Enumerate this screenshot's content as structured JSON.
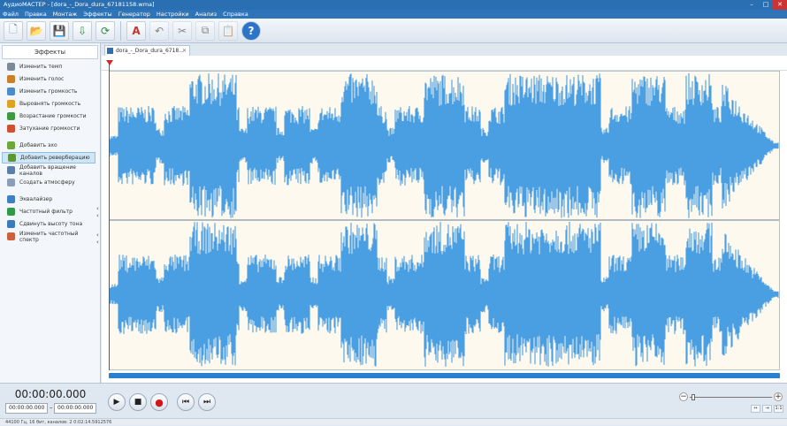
{
  "window": {
    "title": "АудиоМАСТЕР - [dora_-_Dora_dura_67181158.wma]"
  },
  "menu": [
    "Файл",
    "Правка",
    "Монтаж",
    "Эффекты",
    "Генератор",
    "Настройки",
    "Анализ",
    "Справка"
  ],
  "toolbar": {
    "buttons": [
      {
        "icon": "new-file-icon",
        "glyph": "🗋"
      },
      {
        "icon": "open-folder-icon",
        "glyph": "📂"
      },
      {
        "icon": "save-icon",
        "glyph": "💾"
      },
      {
        "icon": "export-icon",
        "glyph": "⇩"
      },
      {
        "icon": "refresh-icon",
        "glyph": "⟳"
      },
      {
        "icon": "edit-text-icon",
        "glyph": "A"
      },
      {
        "icon": "undo-icon",
        "glyph": "↶"
      },
      {
        "icon": "cut-icon",
        "glyph": "✂"
      },
      {
        "icon": "copy-icon",
        "glyph": "⧉"
      },
      {
        "icon": "paste-icon",
        "glyph": "📋"
      },
      {
        "icon": "help-icon",
        "glyph": "?"
      }
    ]
  },
  "sidebar": {
    "header": "Эффекты",
    "items": [
      {
        "label": "Изменить темп",
        "color": "#7a8a99"
      },
      {
        "label": "Изменить голос",
        "color": "#c9802a"
      },
      {
        "label": "Изменить громкость",
        "color": "#4d8bc9"
      },
      {
        "label": "Выровнять громкость",
        "color": "#e0a020"
      },
      {
        "label": "Возрастание громкости",
        "color": "#3d9a3d"
      },
      {
        "label": "Затухание громкости",
        "color": "#d05030"
      },
      {
        "label": "Добавить эхо",
        "color": "#6aa83a"
      },
      {
        "label": "Добавить реверберацию",
        "color": "#5b9a2a"
      },
      {
        "label": "Добавить вращение каналов",
        "color": "#5a7fa8"
      },
      {
        "label": "Создать атмосферу",
        "color": "#8aa0b8"
      },
      {
        "label": "Эквалайзер",
        "color": "#3f7fc4"
      },
      {
        "label": "Частотный фильтр",
        "color": "#2e9a4a"
      },
      {
        "label": "Сдвинуть высоту тона",
        "color": "#3a7ac0"
      },
      {
        "label": "Изменить частотный спектр",
        "color": "#d0603a"
      }
    ],
    "selected_index": 7
  },
  "tab": {
    "label": "dora_-_Dora_dura_6718..."
  },
  "waveform": {
    "color": "#4a9ee2",
    "background": "#fdf9ef"
  },
  "playback": {
    "current_time": "00:00:00.000",
    "selection_start": "00:00:00.000",
    "selection_end": "00:00:00.000"
  },
  "bottom_buttons": {
    "fit": "↔",
    "zoom_sel": "⇥",
    "one_to_one": "1:1"
  },
  "status": {
    "text": "44100 Гц, 16 бит, каналов: 2     0:02:14.5912576"
  }
}
